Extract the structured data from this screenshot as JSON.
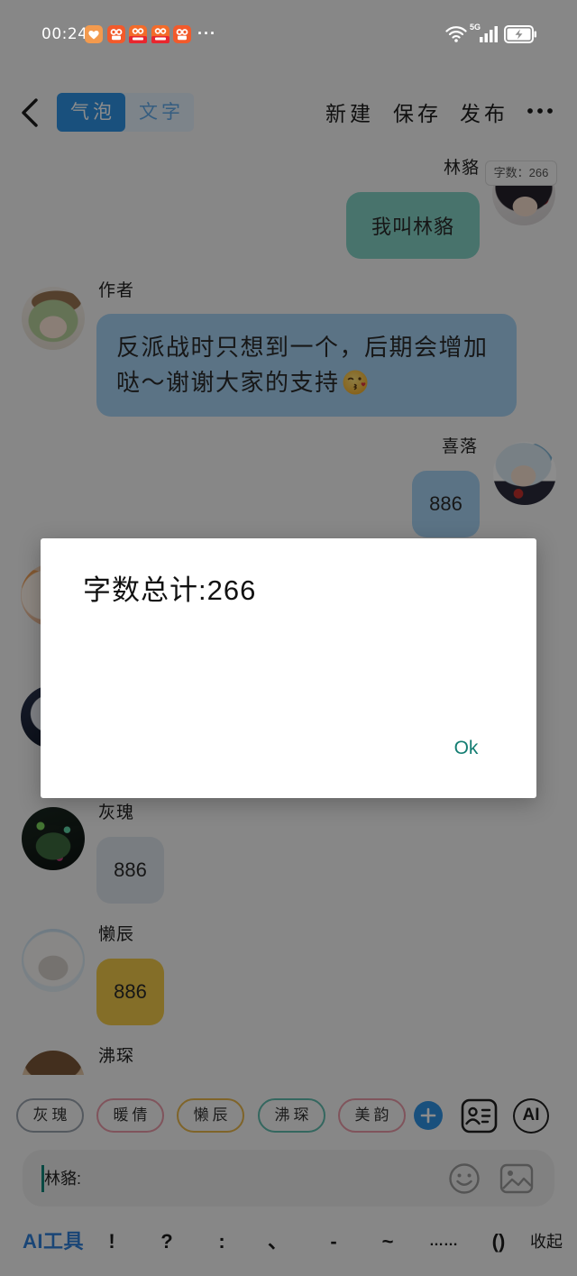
{
  "status_bar": {
    "time": "00:24",
    "notification_icons": [
      "heart-app-icon",
      "kuaishou-app-icon",
      "kuaishou-app-icon",
      "kuaishou-app-icon",
      "kuaishou-app-icon"
    ],
    "overflow": "···",
    "network_type": "5G",
    "system_icons": [
      "wifi-icon",
      "signal-icon",
      "battery-charging-icon"
    ]
  },
  "header": {
    "back_icon": "chevron-left-icon",
    "tabs": [
      {
        "label": "气泡",
        "selected": true
      },
      {
        "label": "文字",
        "selected": false
      }
    ],
    "actions": [
      {
        "label": "新建"
      },
      {
        "label": "保存"
      },
      {
        "label": "发布"
      }
    ],
    "more_icon": "more-horizontal-icon"
  },
  "word_count_badge": "字数：266",
  "messages": [
    {
      "name": "林貉",
      "text": "我叫林貉",
      "bubble_color": "#84d2c5"
    },
    {
      "name": "作者",
      "text": "反派战时只想到一个，后期会增加哒～谢谢大家的支持",
      "emoji_icon": "kissing-face-icon",
      "bubble_color": "#a6d2f3"
    },
    {
      "name": "喜落",
      "text": "886",
      "bubble_color": "#a6d2f3"
    },
    {
      "name": "灰瑰",
      "text": "886",
      "bubble_color": "#dde3eb"
    },
    {
      "name": "懒辰",
      "text": "886",
      "bubble_color": "#f0c849"
    },
    {
      "name": "沸琛"
    }
  ],
  "character_chips": [
    {
      "label": "灰瑰",
      "color": "#9aa3ad"
    },
    {
      "label": "暖倩",
      "color": "#ea9aa8"
    },
    {
      "label": "懒辰",
      "color": "#e8b64c"
    },
    {
      "label": "沸琛",
      "color": "#5fbcae"
    },
    {
      "label": "美韵",
      "color": "#ea9aa8"
    }
  ],
  "chip_actions": {
    "add_icon": "plus-icon",
    "roles_icon": "contact-card-icon",
    "ai_label": "AI"
  },
  "composer": {
    "value": "林貉:",
    "emoji_icon": "smiley-icon",
    "image_icon": "image-icon"
  },
  "quick_bar": {
    "ai_tools_label": "AI工具",
    "symbols": [
      "!",
      "?",
      ":",
      "、",
      "-",
      "~",
      "……",
      "()"
    ],
    "collapse_label": "收起"
  },
  "dialog": {
    "title": "字数总计:266",
    "ok_label": "Ok"
  },
  "colors": {
    "accent": "#2f93e4",
    "accent_text": "#2f7fd8",
    "dialog_ok": "#137d72",
    "caret": "#12857a",
    "scrim": "rgba(0,0,0,0.45)"
  }
}
